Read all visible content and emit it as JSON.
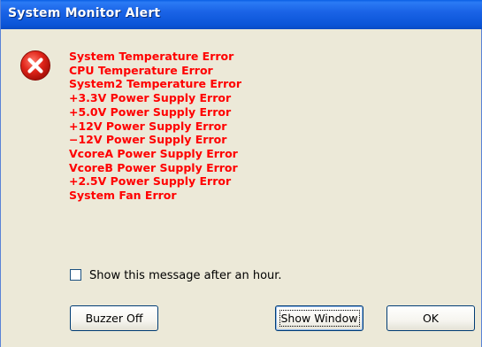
{
  "window": {
    "title": "System Monitor Alert"
  },
  "alert": {
    "icon": "error-icon",
    "messages": [
      "System Temperature Error",
      "CPU Temperature Error",
      "System2 Temperature Error",
      "+3.3V Power Supply Error",
      "+5.0V Power Supply Error",
      "+12V Power Supply Error",
      "−12V Power Supply Error",
      "VcoreA Power Supply Error",
      "VcoreB Power Supply Error",
      "+2.5V Power Supply Error",
      "System Fan Error"
    ],
    "message_color": "#ff0000"
  },
  "options": {
    "show_later_label": "Show this message after an hour.",
    "show_later_checked": false
  },
  "buttons": {
    "buzzer_off": "Buzzer Off",
    "show_window": "Show Window",
    "ok": "OK"
  }
}
